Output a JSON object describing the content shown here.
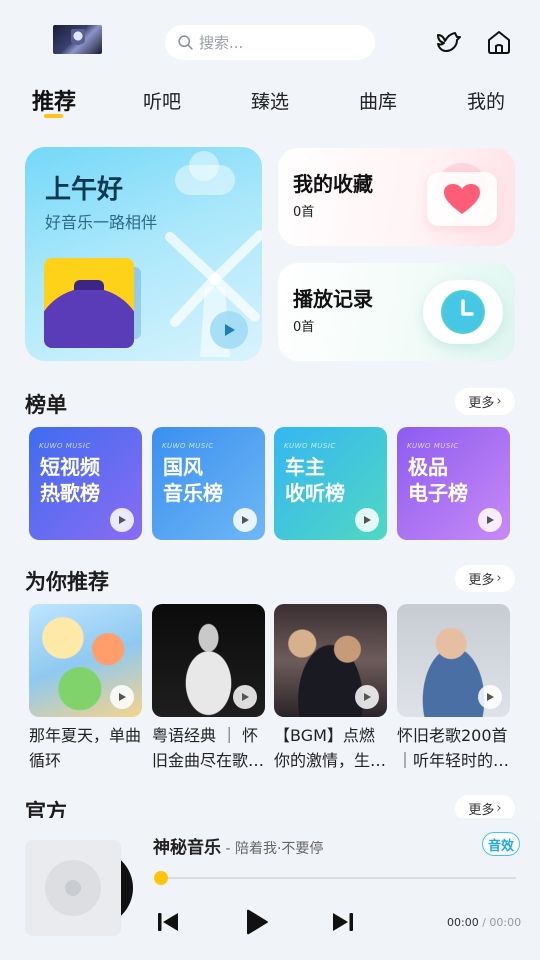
{
  "header": {
    "search_placeholder": "搜索..."
  },
  "tabs": [
    {
      "label": "推荐",
      "active": true
    },
    {
      "label": "听吧",
      "active": false
    },
    {
      "label": "臻选",
      "active": false
    },
    {
      "label": "曲库",
      "active": false
    },
    {
      "label": "我的",
      "active": false
    }
  ],
  "greeting": {
    "title": "上午好",
    "subtitle": "好音乐一路相伴"
  },
  "favorites": {
    "title": "我的收藏",
    "count": "0首"
  },
  "history": {
    "title": "播放记录",
    "count": "0首"
  },
  "charts": {
    "title": "榜单",
    "more": "更多",
    "items": [
      {
        "tag": "KUWO MUSIC",
        "name": "短视频\n热歌榜",
        "color_a": "#3f6cf0",
        "color_b": "#8a6cf2"
      },
      {
        "tag": "KUWO MUSIC",
        "name": "国风\n音乐榜",
        "color_a": "#3a8ff0",
        "color_b": "#6fb8f5"
      },
      {
        "tag": "KUWO MUSIC",
        "name": "车主\n收听榜",
        "color_a": "#35b6f2",
        "color_b": "#4fd8c2"
      },
      {
        "tag": "KUWO MUSIC",
        "name": "极品\n电子榜",
        "color_a": "#8d5cf0",
        "color_b": "#c78af6"
      }
    ]
  },
  "recommend": {
    "title": "为你推荐",
    "more": "更多",
    "items": [
      {
        "title": "那年夏天，单曲循环"
      },
      {
        "title": "粤语经典 ｜ 怀旧金曲尽在歌…"
      },
      {
        "title": "【BGM】点燃你的激情，生…"
      },
      {
        "title": "怀旧老歌200首 ｜听年轻时的…"
      }
    ]
  },
  "official": {
    "title": "官方",
    "more": "更多"
  },
  "player": {
    "title": "神秘音乐",
    "artist": " - 陪着我·不要停",
    "effect_label": "音效",
    "current_time": "00:00",
    "separator": " / ",
    "duration": "00:00",
    "progress": 0
  },
  "colors": {
    "accent": "#ffc21a",
    "effect": "#36c9ff"
  }
}
